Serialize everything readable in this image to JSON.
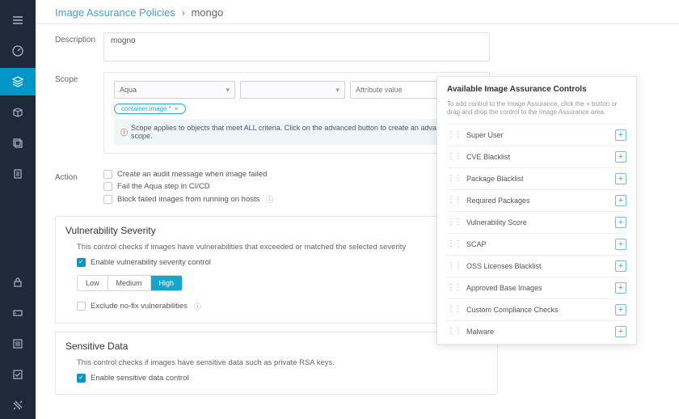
{
  "breadcrumb": {
    "root": "Image Assurance Policies",
    "leaf": "mongo"
  },
  "labels": {
    "description": "Description",
    "scope": "Scope",
    "action": "Action"
  },
  "description_value": "mogno",
  "scope": {
    "select1": "Aqua",
    "attr_placeholder": "Attribute value",
    "chip": "container.image *",
    "note": "Scope applies to objects that meet ALL criteria. Click on the advanced button to create an advanced scope."
  },
  "actions": {
    "a1": "Create an audit message when image failed",
    "a2": "Fail the Aqua step in CI/CD",
    "a3": "Block failed images from running on hosts"
  },
  "vuln": {
    "title": "Vulnerability Severity",
    "desc": "This control checks if images have vulnerabilities that exceeded or matched the selected severity",
    "enable": "Enable vulnerability severity control",
    "low": "Low",
    "medium": "Medium",
    "high": "High",
    "exclude": "Exclude no-fix vulnerabilities"
  },
  "sensitive": {
    "title": "Sensitive Data",
    "desc": "This control checks if images have sensitive data such as private RSA keys.",
    "enable": "Enable sensitive data control"
  },
  "panel": {
    "title": "Available Image Assurance Controls",
    "hint": "To add control to the Image Assurance, click the + button or drag and drop the control to the Image Assurance area.",
    "items": [
      "Super User",
      "CVE Blacklist",
      "Package Blacklist",
      "Required Packages",
      "Vulnerability Score",
      "SCAP",
      "OSS Licenses Blacklist",
      "Approved Base Images",
      "Custom Compliance Checks",
      "Malware"
    ]
  }
}
